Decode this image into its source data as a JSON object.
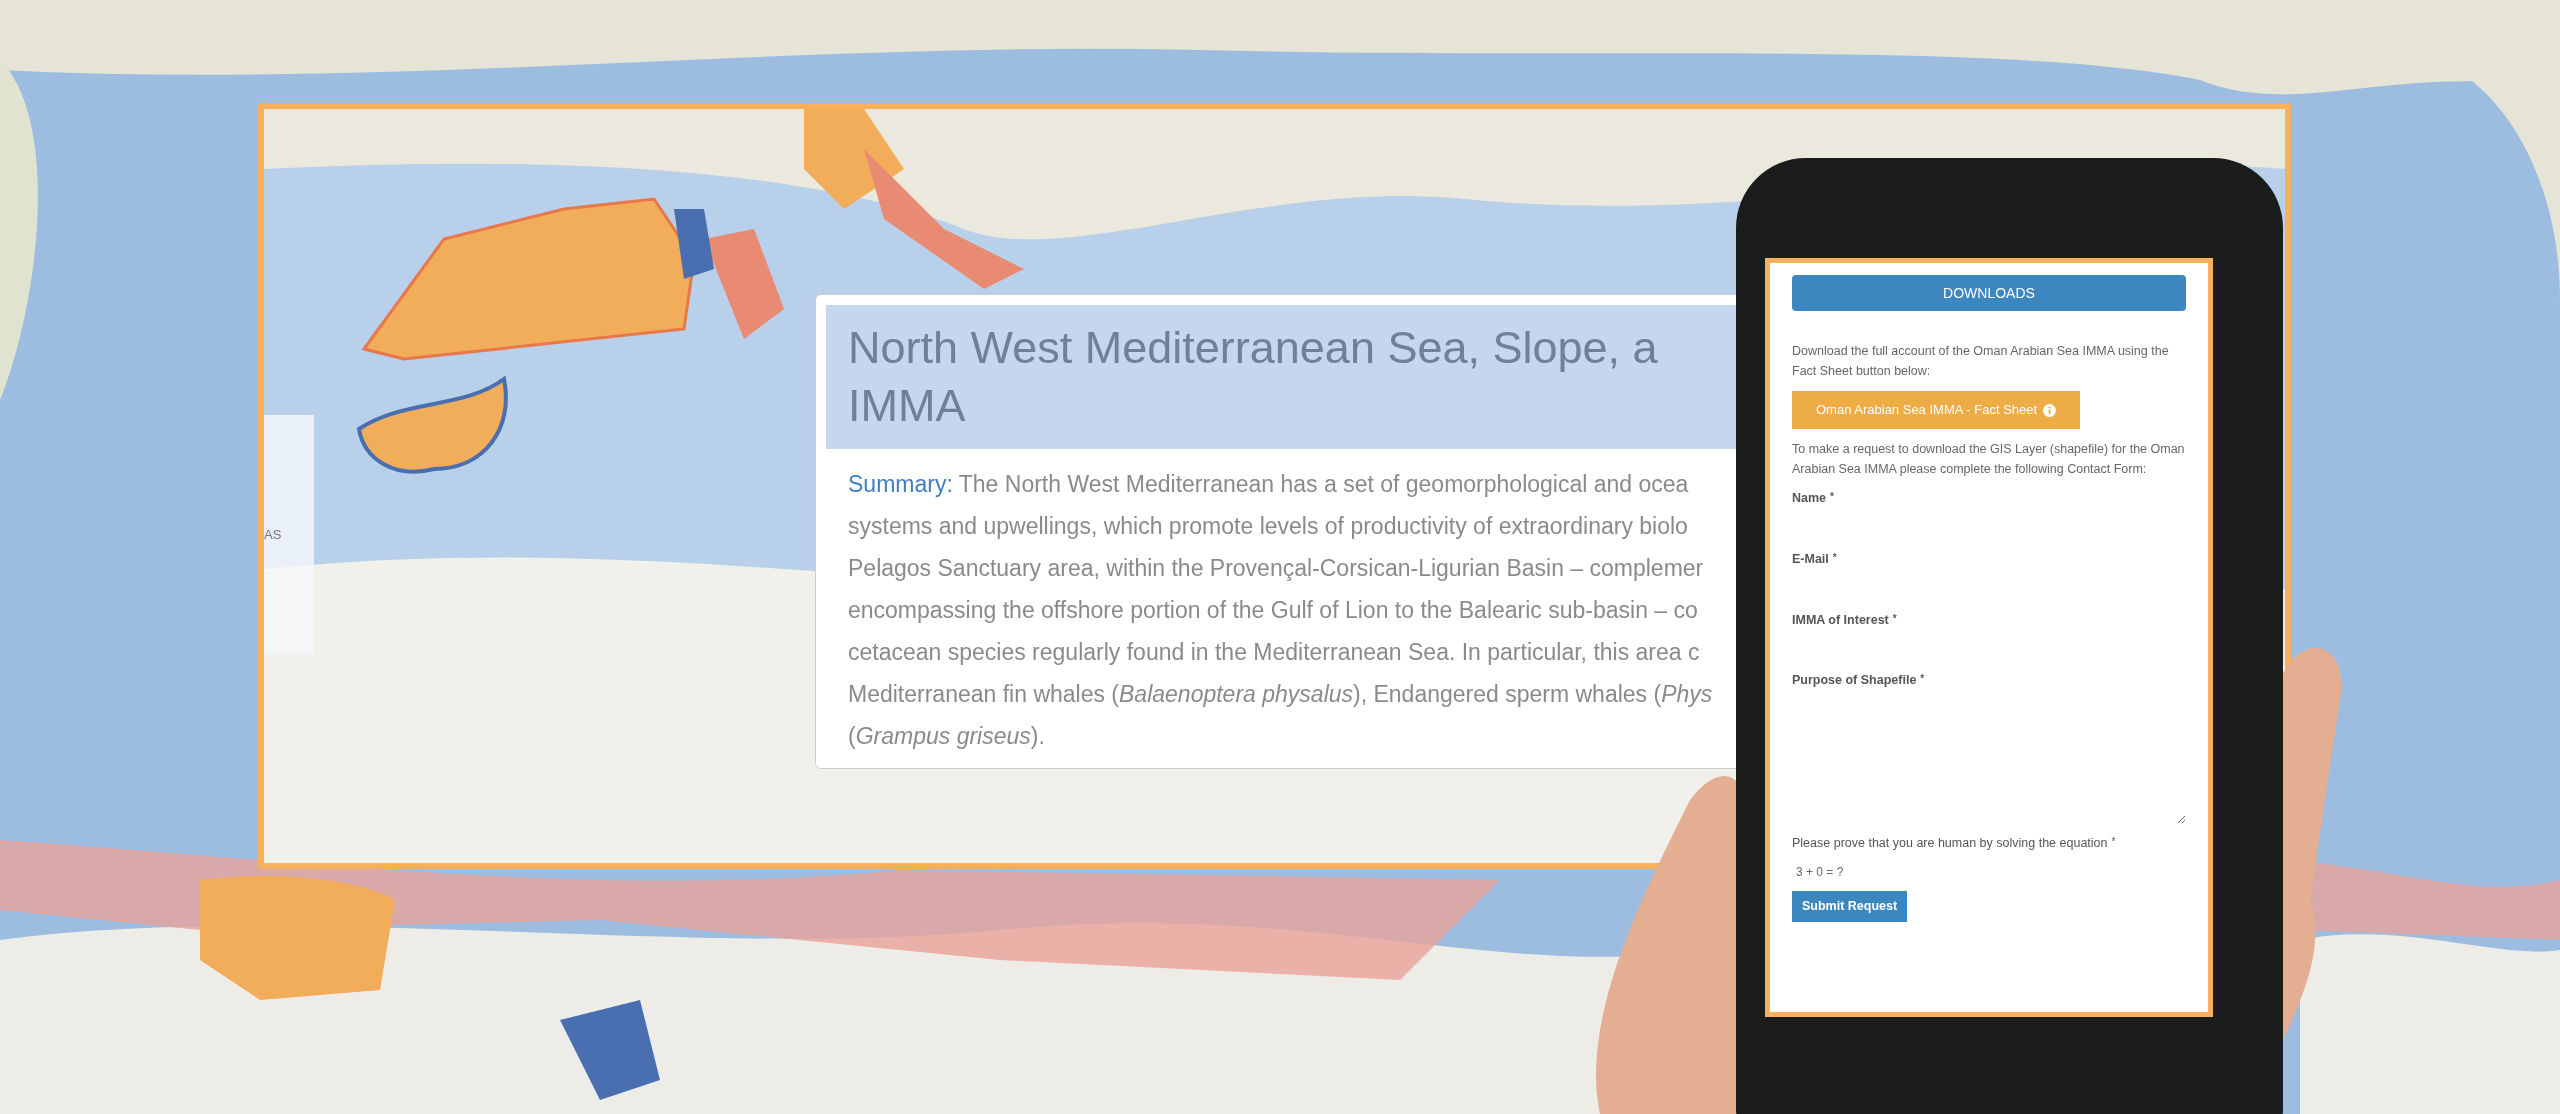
{
  "map_frame": {
    "legend_fragment": "AS"
  },
  "summary_card": {
    "title_lines": [
      "North West Mediterranean Sea, Slope, a",
      "IMMA"
    ],
    "summary_lines": [
      "**Summary:** The North West Mediterranean has a set of geomorphological and ocea",
      "systems and upwellings, which promote levels of productivity of extraordinary biolo",
      "Pelagos Sanctuary area, within the Provençal-Corsican-Ligurian Basin – complemer",
      "encompassing the offshore portion of the Gulf of Lion to the Balearic sub-basin – co",
      "cetacean species regularly found in the Mediterranean Sea. In particular, this area c",
      "Mediterranean fin whales (*Balaenoptera physalus*), Endangered sperm whales (*Phys*",
      "(*Grampus griseus*)."
    ]
  },
  "phone_form": {
    "section_button": "DOWNLOADS",
    "intro": "Download the full account of the Oman Arabian Sea IMMA using the Fact Sheet button below:",
    "fact_sheet_button": "Oman Arabian Sea IMMA - Fact Sheet",
    "request_text": "To make a request to download the GIS Layer (shapefile) for the Oman Arabian Sea IMMA please complete the following Contact Form:",
    "fields": [
      {
        "label": "Name",
        "required_mark": "*",
        "kind": "input"
      },
      {
        "label": "E-Mail",
        "required_mark": "*",
        "kind": "input"
      },
      {
        "label": "IMMA of Interest",
        "required_mark": "*",
        "kind": "input"
      },
      {
        "label": "Purpose of Shapefile",
        "required_mark": "*",
        "kind": "textarea"
      }
    ],
    "captcha_label": "Please prove that you are human by solving the equation",
    "captcha_required_mark": "*",
    "captcha": "3 + 0 = ?",
    "submit_button": "Submit Request"
  }
}
